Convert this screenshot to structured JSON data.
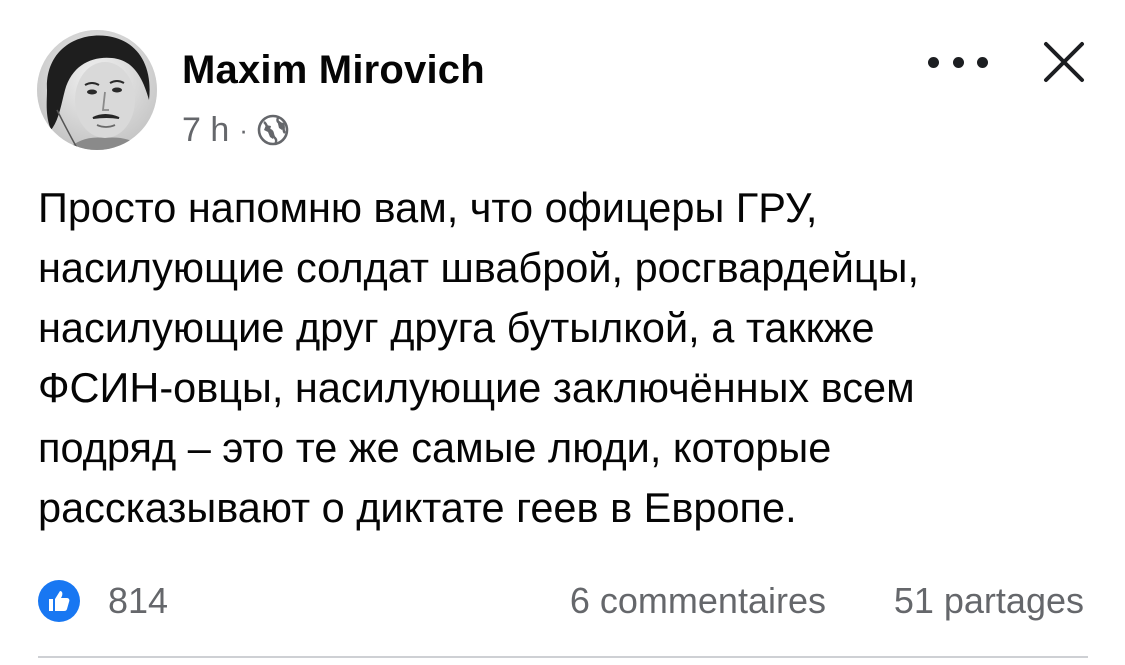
{
  "post": {
    "author": {
      "name": "Maxim Mirovich",
      "avatar_icon": "profile-photo"
    },
    "meta": {
      "time": "7 h",
      "separator": "·",
      "audience_icon": "globe-icon"
    },
    "menu": {
      "more_icon": "more-horizontal-icon",
      "close_icon": "close-icon"
    },
    "text_lines": [
      "Просто напомню вам, что офицеры ГРУ,",
      "насилующие солдат шваброй, росгвардейцы,",
      "насилующие друг друга бутылкой, а таккже",
      "ФСИН-овцы, насилующие заключённых всем",
      "подряд – это те же самые люди, которые",
      "рассказывают о диктате геев в Европе."
    ],
    "footer": {
      "reaction_icon": "like-icon",
      "reaction_count": "814",
      "comments": "6 commentaires",
      "shares": "51 partages"
    },
    "colors": {
      "accent": "#1877f2",
      "secondary_text": "#65676b",
      "primary_text": "#050505",
      "divider": "#ced0d4"
    }
  }
}
